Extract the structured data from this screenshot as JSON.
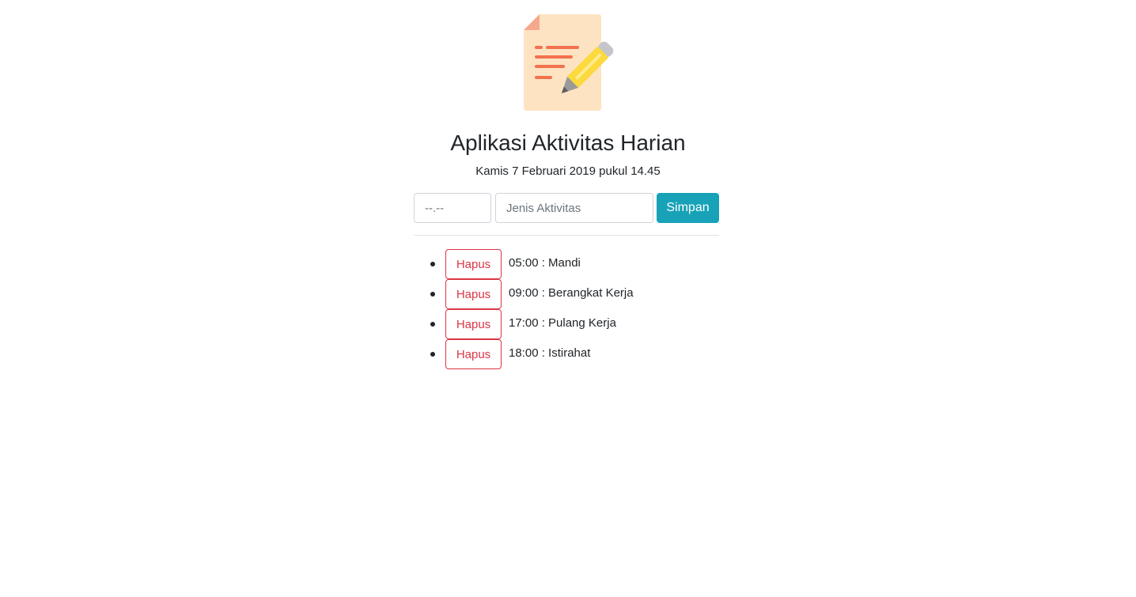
{
  "app": {
    "title": "Aplikasi Aktivitas Harian",
    "datetime": "Kamis 7 Februari 2019 pukul 14.45",
    "logo_icon": "note-pencil-icon"
  },
  "form": {
    "time_placeholder": "--.--",
    "activity_placeholder": "Jenis Aktivitas",
    "save_label": "Simpan"
  },
  "activities": [
    {
      "delete_label": "Hapus",
      "text": "05:00 : Mandi"
    },
    {
      "delete_label": "Hapus",
      "text": "09:00 : Berangkat Kerja"
    },
    {
      "delete_label": "Hapus",
      "text": "17:00 : Pulang Kerja"
    },
    {
      "delete_label": "Hapus",
      "text": "18:00 : Istirahat"
    }
  ],
  "colors": {
    "primary_info": "#17a2b8",
    "danger": "#dc3545",
    "text": "#212529"
  }
}
